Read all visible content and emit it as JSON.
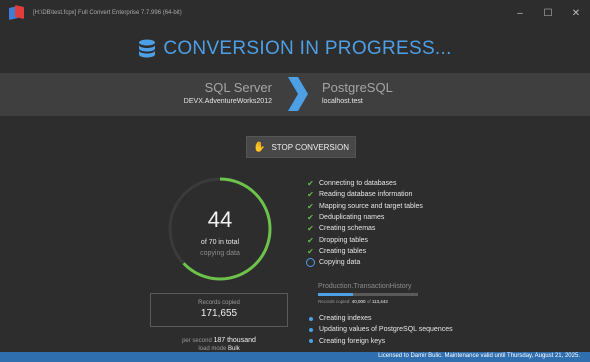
{
  "window": {
    "title": "[H:\\DB\\test.fcpx] Full Convert Enterprise 7.7.996 (64-bit)",
    "controls": {
      "minimize": "–",
      "maximize": "☐",
      "close": "✕"
    }
  },
  "heading": {
    "icon": "database-icon",
    "text": "CONVERSION IN PROGRESS..."
  },
  "source": {
    "db_type": "SQL Server",
    "connection": "DEVX.AdventureWorks2012"
  },
  "target": {
    "db_type": "PostgreSQL",
    "connection": "localhost.test"
  },
  "stop_button": {
    "icon": "hand-stop-icon",
    "label": "STOP CONVERSION"
  },
  "progress": {
    "current": "44",
    "total_text": "of 70 in total",
    "status": "copying data",
    "fraction": 0.629
  },
  "records": {
    "label": "Records copied",
    "value": "171,655"
  },
  "speed": {
    "prefix": "per second",
    "value": "187 thousand"
  },
  "load_mode": {
    "prefix": "load mode",
    "value": "Bulk"
  },
  "steps_done": [
    "Connecting to databases",
    "Reading database information",
    "Mapping source and target tables",
    "Deduplicating names",
    "Creating schemas",
    "Dropping tables",
    "Creating tables"
  ],
  "step_current": "Copying data",
  "table_progress": {
    "name": "Production.TransactionHistory",
    "rows_prefix": "Records copied:",
    "rows_done": "40,000",
    "rows_of": "of",
    "rows_total": "113,443",
    "fraction": 0.353
  },
  "steps_pending": [
    "Creating indexes",
    "Updating values of PostgreSQL sequences",
    "Creating foreign keys"
  ],
  "license": "Licensed to Damir Bulic. Maintenance valid until Thursday, August 21, 2025.",
  "colors": {
    "accent": "#4d9fe6",
    "success": "#5fbe4b",
    "background": "#2d2d2d",
    "statusbar": "#2f6fb0"
  }
}
